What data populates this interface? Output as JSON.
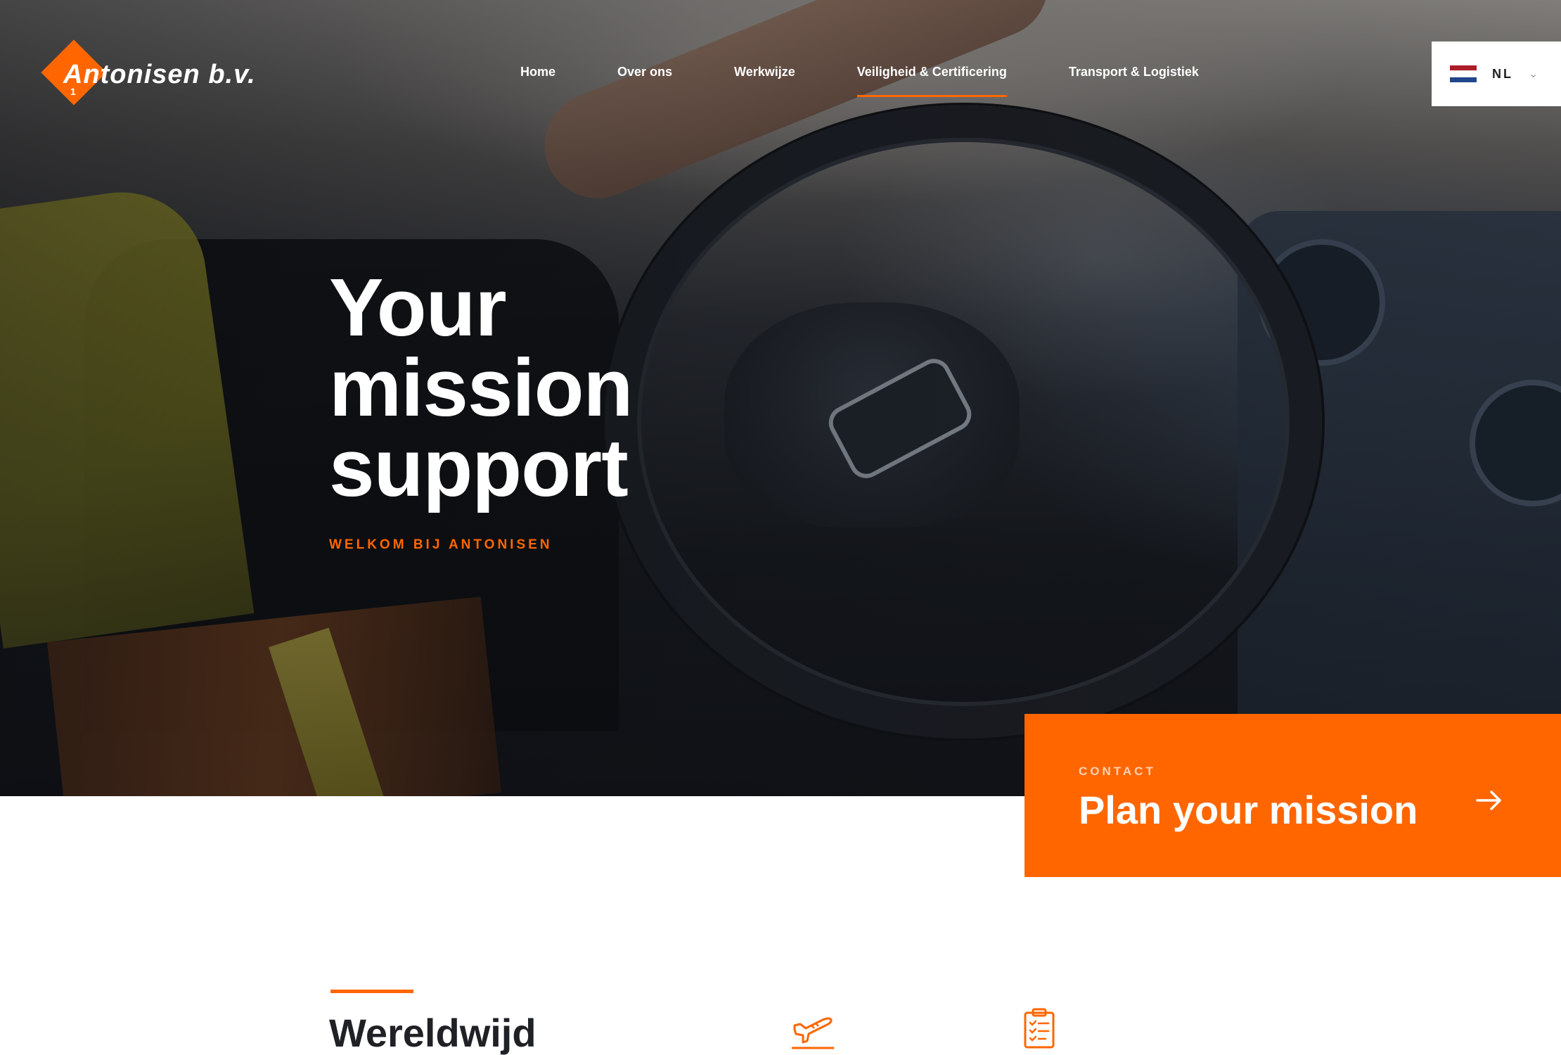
{
  "brand": {
    "name": "Antonisen b.v.",
    "mark_number": "1",
    "accent_color": "#ff6600"
  },
  "nav": {
    "items": [
      {
        "label": "Home",
        "active": false
      },
      {
        "label": "Over ons",
        "active": false
      },
      {
        "label": "Werkwijze",
        "active": false
      },
      {
        "label": "Veiligheid & Certificering",
        "active": true
      },
      {
        "label": "Transport & Logistiek",
        "active": false
      }
    ]
  },
  "language": {
    "code": "NL",
    "flag_icon": "netherlands-flag-icon",
    "dropdown_icon": "chevron-down-icon"
  },
  "hero": {
    "title_lines": [
      "Your",
      "mission",
      "support"
    ],
    "subtitle": "WELKOM BIJ ANTONISEN"
  },
  "cta": {
    "kicker": "CONTACT",
    "title": "Plan your mission",
    "icon": "arrow-right-icon"
  },
  "section": {
    "title": "Wereldwijd",
    "icons": [
      "airplane-icon",
      "clipboard-checklist-icon"
    ]
  }
}
